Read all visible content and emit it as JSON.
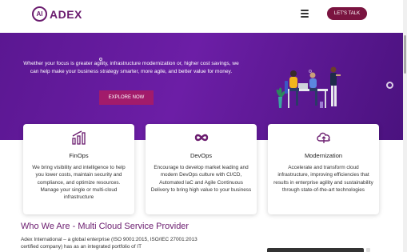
{
  "header": {
    "logo_mark": "AI",
    "logo_text": "ADEX",
    "cta_label": "LET'S TALK"
  },
  "hero": {
    "text": "Whether your focus is greater agility, infrastructure modernization or, higher cost savings, we can help make your business strategy smarter, more agile, and better value for money.",
    "button_label": "EXPLORE NOW",
    "colors": {
      "background": "#5b1792",
      "button": "#a21b6b"
    }
  },
  "cards": [
    {
      "icon": "bar-chart-icon",
      "title": "FinOps",
      "text": "We bring visibility and intelligence to help you lower costs, maintain security and compliance, and optimize resources. Manage your single or multi-cloud infrastructure"
    },
    {
      "icon": "infinity-icon",
      "title": "DevOps",
      "text": "Encourage to develop market leading and modern DevOps culture with CI/CD, Automated IaC and Agile Continuous Delivery to bring high value to your business"
    },
    {
      "icon": "cloud-icon",
      "title": "Modernization",
      "text": "Accelerate and transform cloud infrastructure, improving efficiencies that results in enterprise agility and sustainability through state-of-the-art technologies"
    }
  ],
  "about": {
    "title": "Who We Are - Multi Cloud Service Provider",
    "text": "Adex International – a global enterprise (ISO 9001:2015, ISO/IEC 27001:2013 certified company) has as an integrated portfolio of IT"
  },
  "colors": {
    "brand": "#6a1b6e",
    "cta": "#7a1440"
  }
}
